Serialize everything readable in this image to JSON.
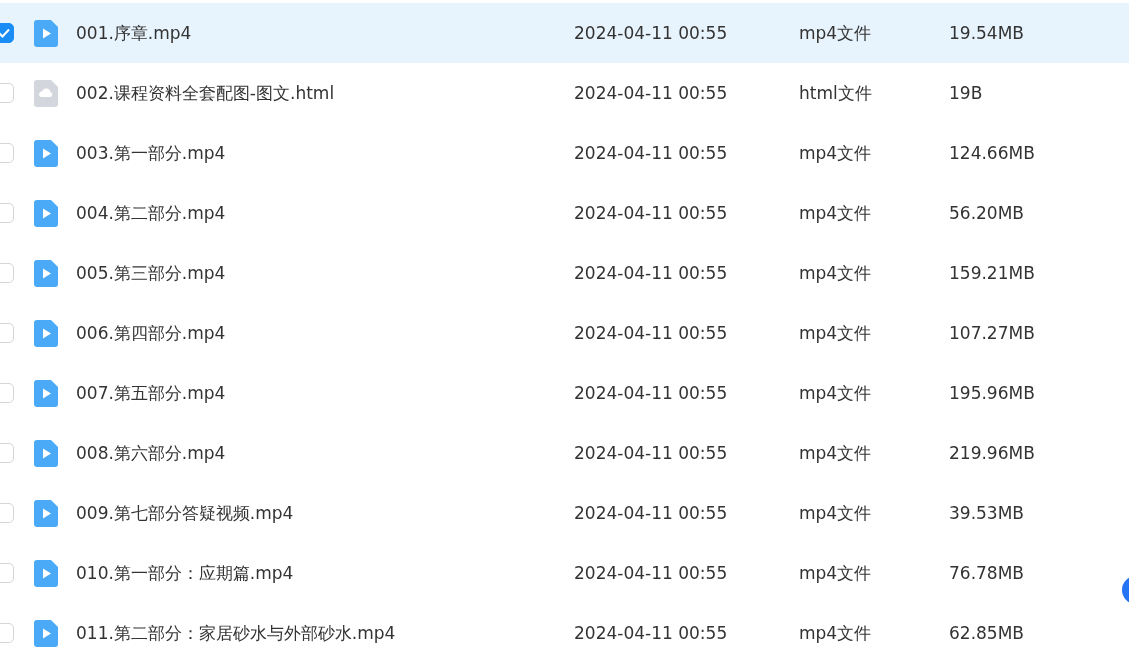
{
  "files": [
    {
      "name": "001.序章.mp4",
      "date": "2024-04-11 00:55",
      "type": "mp4文件",
      "size": "19.54MB",
      "kind": "video",
      "selected": true
    },
    {
      "name": "002.课程资料全套配图-图文.html",
      "date": "2024-04-11 00:55",
      "type": "html文件",
      "size": "19B",
      "kind": "document",
      "selected": false
    },
    {
      "name": "003.第一部分.mp4",
      "date": "2024-04-11 00:55",
      "type": "mp4文件",
      "size": "124.66MB",
      "kind": "video",
      "selected": false
    },
    {
      "name": "004.第二部分.mp4",
      "date": "2024-04-11 00:55",
      "type": "mp4文件",
      "size": "56.20MB",
      "kind": "video",
      "selected": false
    },
    {
      "name": "005.第三部分.mp4",
      "date": "2024-04-11 00:55",
      "type": "mp4文件",
      "size": "159.21MB",
      "kind": "video",
      "selected": false
    },
    {
      "name": "006.第四部分.mp4",
      "date": "2024-04-11 00:55",
      "type": "mp4文件",
      "size": "107.27MB",
      "kind": "video",
      "selected": false
    },
    {
      "name": "007.第五部分.mp4",
      "date": "2024-04-11 00:55",
      "type": "mp4文件",
      "size": "195.96MB",
      "kind": "video",
      "selected": false
    },
    {
      "name": "008.第六部分.mp4",
      "date": "2024-04-11 00:55",
      "type": "mp4文件",
      "size": "219.96MB",
      "kind": "video",
      "selected": false
    },
    {
      "name": "009.第七部分答疑视频.mp4",
      "date": "2024-04-11 00:55",
      "type": "mp4文件",
      "size": "39.53MB",
      "kind": "video",
      "selected": false
    },
    {
      "name": "010.第一部分：应期篇.mp4",
      "date": "2024-04-11 00:55",
      "type": "mp4文件",
      "size": "76.78MB",
      "kind": "video",
      "selected": false
    },
    {
      "name": "011.第二部分：家居砂水与外部砂水.mp4",
      "date": "2024-04-11 00:55",
      "type": "mp4文件",
      "size": "62.85MB",
      "kind": "video",
      "selected": false
    }
  ]
}
